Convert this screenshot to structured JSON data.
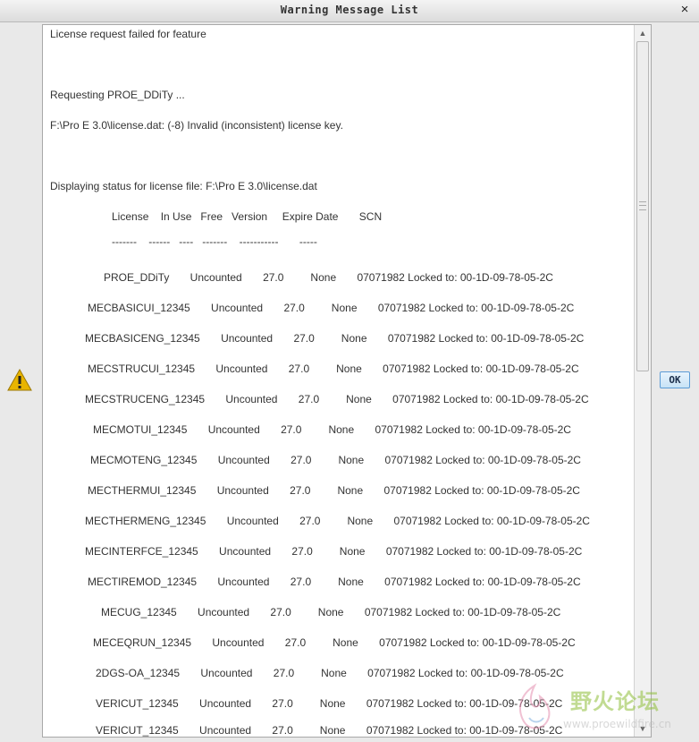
{
  "window": {
    "title": "Warning Message List",
    "close_glyph": "×"
  },
  "message_lines": [
    {
      "text": "License request failed for feature",
      "indent": 8
    },
    {
      "text": "Requesting PROE_DDiTy ...",
      "indent": 8
    },
    {
      "text": "F:\\Pro E 3.0\\license.dat: (-8) Invalid (inconsistent) license key.",
      "indent": 8
    },
    {
      "text": "Displaying status for license file: F:\\Pro E 3.0\\license.dat",
      "indent": 8
    },
    {
      "text": "License    In Use   Free   Version     Expire Date       SCN",
      "indent": 77
    },
    {
      "text": "-------    ------   ----   -------    -----------       -----",
      "indent": 77
    },
    {
      "text": "PROE_DDiTy       Uncounted       27.0         None       07071982 Locked to: 00-1D-09-78-05-2C",
      "indent": 68
    },
    {
      "text": "MECBASICUI_12345       Uncounted       27.0         None       07071982 Locked to: 00-1D-09-78-05-2C",
      "indent": 50
    },
    {
      "text": "MECBASICENG_12345       Uncounted       27.0         None       07071982 Locked to: 00-1D-09-78-05-2C",
      "indent": 47
    },
    {
      "text": "MECSTRUCUI_12345       Uncounted       27.0         None       07071982 Locked to: 00-1D-09-78-05-2C",
      "indent": 50
    },
    {
      "text": "MECSTRUCENG_12345       Uncounted       27.0         None       07071982 Locked to: 00-1D-09-78-05-2C",
      "indent": 47
    },
    {
      "text": "MECMOTUI_12345       Uncounted       27.0         None       07071982 Locked to: 00-1D-09-78-05-2C",
      "indent": 56
    },
    {
      "text": "MECMOTENG_12345       Uncounted       27.0         None       07071982 Locked to: 00-1D-09-78-05-2C",
      "indent": 53
    },
    {
      "text": "MECTHERMUI_12345       Uncounted       27.0         None       07071982 Locked to: 00-1D-09-78-05-2C",
      "indent": 50
    },
    {
      "text": "MECTHERMENG_12345       Uncounted       27.0         None       07071982 Locked to: 00-1D-09-78-05-2C",
      "indent": 47
    },
    {
      "text": "MECINTERFCE_12345       Uncounted       27.0         None       07071982 Locked to: 00-1D-09-78-05-2C",
      "indent": 47
    },
    {
      "text": "MECTIREMOD_12345       Uncounted       27.0         None       07071982 Locked to: 00-1D-09-78-05-2C",
      "indent": 50
    },
    {
      "text": "MECUG_12345       Uncounted       27.0         None       07071982 Locked to: 00-1D-09-78-05-2C",
      "indent": 65
    },
    {
      "text": "MECEQRUN_12345       Uncounted       27.0         None       07071982 Locked to: 00-1D-09-78-05-2C",
      "indent": 56
    },
    {
      "text": "2DGS-OA_12345       Uncounted       27.0         None       07071982 Locked to: 00-1D-09-78-05-2C",
      "indent": 59
    },
    {
      "text": "VERICUT_12345       Uncounted       27.0         None       07071982 Locked to: 00-1D-09-78-05-2C",
      "indent": 59
    },
    {
      "text": "VERICUT_12345       Uncounted       27.0         None       07071982 Locked to: 00-1D-09-78-05-2C",
      "indent": 59
    }
  ],
  "ok_button": {
    "label": "OK"
  },
  "watermark": {
    "text": "野火论坛",
    "url": "www.proewildfire.cn"
  },
  "colors": {
    "warning_icon": "#e8b400",
    "ok_border": "#5b9bd5",
    "watermark_green": "#8fbf3a"
  },
  "icons": {
    "warning": "warning-triangle-icon",
    "close": "close-icon"
  }
}
